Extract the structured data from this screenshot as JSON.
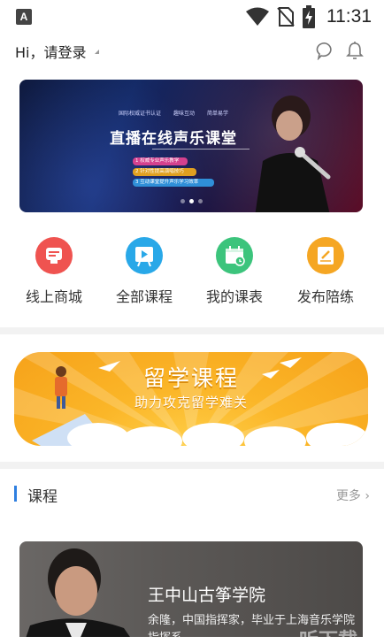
{
  "status_bar": {
    "app_icon_letter": "A",
    "time": "11:31",
    "icons": [
      "wifi-icon",
      "no-sim-icon",
      "battery-charging-icon"
    ]
  },
  "header": {
    "greeting": "Hi，请登录",
    "icons": [
      "chat-icon",
      "bell-icon"
    ]
  },
  "banner": {
    "top_tags": [
      "国际权威证书认证",
      "趣味互动",
      "简单易学"
    ],
    "title": "直播在线声乐课堂",
    "bullets": [
      "1 权威专业声乐教学",
      "2 针对性提高演唱技巧",
      "3 互动课堂提升声乐学习效率"
    ],
    "page_count": 3,
    "active_page": 2
  },
  "quick_menu": [
    {
      "label": "线上商城",
      "icon": "store-icon",
      "color": "#ef5350"
    },
    {
      "label": "全部课程",
      "icon": "play-board-icon",
      "color": "#29a8e8"
    },
    {
      "label": "我的课表",
      "icon": "calendar-icon",
      "color": "#3cc47c"
    },
    {
      "label": "发布陪练",
      "icon": "edit-book-icon",
      "color": "#f5a623"
    }
  ],
  "study_abroad_banner": {
    "title": "留学课程",
    "subtitle": "助力攻克留学难关"
  },
  "course_section": {
    "title": "课程",
    "more_label": "更多",
    "accent_color": "#2f7fe0"
  },
  "course_card": {
    "name": "王中山古筝学院",
    "description": "余隆，中国指挥家，毕业于上海音乐学院指挥系"
  },
  "watermark": "听下载"
}
